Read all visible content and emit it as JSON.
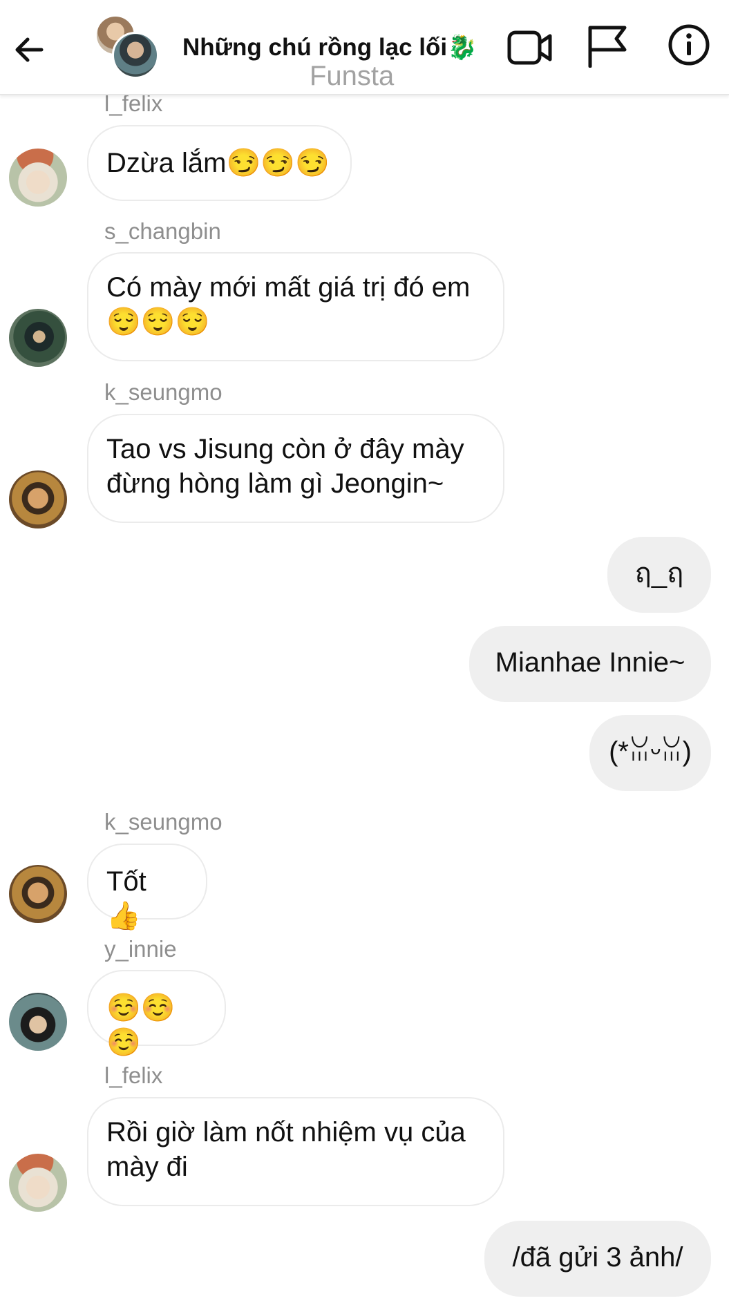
{
  "header": {
    "title": "Những chú rồng lạc lối🐉",
    "subtitle": "Funsta",
    "icons": [
      "back-arrow-icon",
      "video-call-icon",
      "flag-icon",
      "info-icon"
    ]
  },
  "messages": [
    {
      "sender": "l_felix",
      "text": "Dzừa lắm😏😏😏"
    },
    {
      "sender": "s_changbin",
      "text": "Có mày mới mất giá trị đó em😌😌😌"
    },
    {
      "sender": "k_seungmo",
      "text": "Tao vs Jisung còn ở đây mày đừng hòng làm gì Jeongin~"
    },
    {
      "text": "ฤ_ฤ"
    },
    {
      "text": "Mianhae Innie~"
    },
    {
      "text": "(*ꈍᵕꈍ)"
    },
    {
      "sender": "k_seungmo",
      "text": "Tốt 👍"
    },
    {
      "sender": "y_innie",
      "text": "☺️☺️☺️"
    },
    {
      "sender": "l_felix",
      "text": "Rồi giờ làm nốt nhiệm vụ của mày đi"
    },
    {
      "text": "/đã gửi 3 ảnh/"
    }
  ],
  "colors": {
    "incoming_bubble_bg": "#ffffff",
    "incoming_bubble_border": "#ebebeb",
    "outgoing_bubble_bg": "#efefef",
    "sender_name": "#8e8e8e",
    "subtitle": "#a2a2a2"
  }
}
